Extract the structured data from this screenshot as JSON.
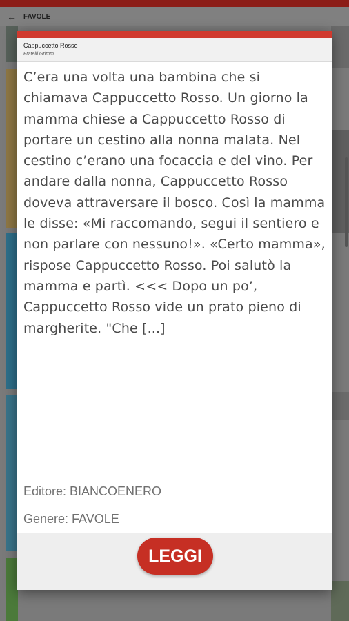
{
  "app": {
    "title": "FAVOLE",
    "back_icon": "arrow-left-icon",
    "status_color": "#8c1d17"
  },
  "dialog": {
    "accent_color": "#d03a2f",
    "book_title": "Cappuccetto Rosso",
    "book_author": "Fratelli Grimm",
    "excerpt": "C’era una volta una bambina che si chiamava Cappuccetto Rosso. Un giorno la mamma chiese a Cappuccetto Rosso di portare un cestino alla nonna malata. Nel cestino c’erano una focaccia e del vino. Per andare dalla nonna, Cappuccetto Rosso doveva attraversare il bosco. Così la mamma le disse: «Mi raccomando, segui il sentiero e non parlare con nessuno!». «Certo mamma», rispose Cappuccetto Rosso. Poi salutò la mamma e partì. <<< Dopo un po’, Cappuccetto Rosso vide un prato pieno di margherite. \"Che [...]",
    "publisher": "Editore: BIANCOENERO",
    "genre": "Genere: FAVOLE",
    "read_button": "LEGGI",
    "button_color": "#c62f24"
  }
}
